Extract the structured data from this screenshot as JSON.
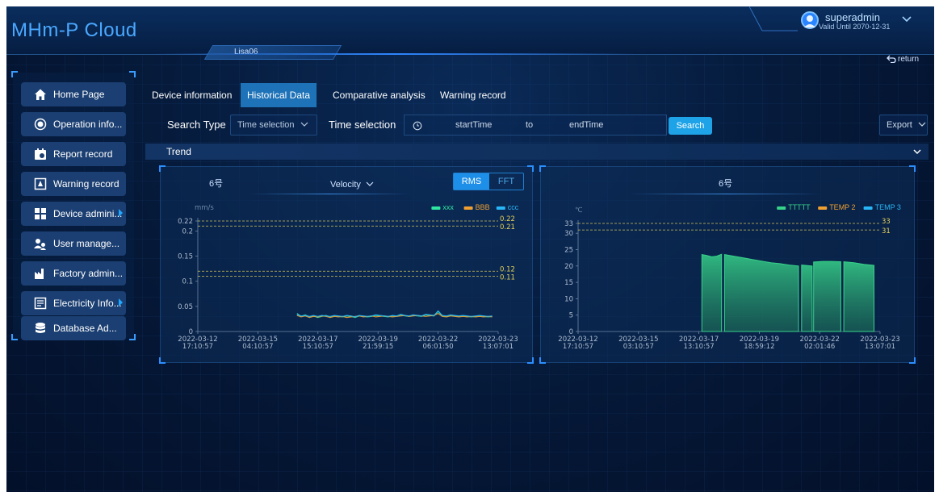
{
  "header": {
    "app_title": "MHm-P Cloud",
    "device_tab": "Lisa06",
    "user_name": "superadmin",
    "valid_until": "Valid Until 2070-12-31",
    "return_label": "return"
  },
  "sidebar": {
    "items": [
      {
        "label": "Home Page",
        "icon": "home-icon",
        "has_submenu": false
      },
      {
        "label": "Operation info...",
        "icon": "target-icon",
        "has_submenu": false
      },
      {
        "label": "Report record",
        "icon": "report-icon",
        "has_submenu": false
      },
      {
        "label": "Warning record",
        "icon": "warning-icon",
        "has_submenu": false
      },
      {
        "label": "Device admini...",
        "icon": "grid-icon",
        "has_submenu": true
      },
      {
        "label": "User manage...",
        "icon": "users-icon",
        "has_submenu": false
      },
      {
        "label": "Factory admin...",
        "icon": "factory-icon",
        "has_submenu": false
      },
      {
        "label": "Electricity Info...",
        "icon": "electricity-icon",
        "has_submenu": true
      },
      {
        "label": "Database Ad...",
        "icon": "database-icon",
        "has_submenu": false
      }
    ]
  },
  "tabs": [
    {
      "label": "Device information",
      "active": false
    },
    {
      "label": "Historical Data",
      "active": true
    },
    {
      "label": "Comparative analysis",
      "active": false
    },
    {
      "label": "Warning record",
      "active": false
    }
  ],
  "search": {
    "search_type_label": "Search Type",
    "search_type_value": "Time selection",
    "time_selection_label": "Time selection",
    "start_placeholder": "startTime",
    "to_label": "to",
    "end_placeholder": "endTime",
    "search_button": "Search",
    "export_button": "Export"
  },
  "trend": {
    "label": "Trend"
  },
  "colors": {
    "accent": "#1ea3e8",
    "series_xxx": "#2ee6a0",
    "series_bbb": "#f0a030",
    "series_ccc": "#29b6f6",
    "series_ttttt": "#37d28a",
    "series_temp2": "#f0a030",
    "series_temp3": "#29b6f6",
    "warning_line": "#e6d25a"
  },
  "chart_data": [
    {
      "type": "line",
      "title": "6号",
      "measure": "Velocity",
      "mode_options": [
        "RMS",
        "FFT"
      ],
      "mode_selected": "RMS",
      "ylabel": "mm/s",
      "ylim": [
        0,
        0.22
      ],
      "yticks": [
        "0",
        "0.05",
        "0.1",
        "0.15",
        "0.2",
        "0.22"
      ],
      "xticks": [
        [
          "2022-03-12",
          "17:10:57"
        ],
        [
          "2022-03-15",
          "04:10:57"
        ],
        [
          "2022-03-17",
          "15:10:57"
        ],
        [
          "2022-03-19",
          "21:59:15"
        ],
        [
          "2022-03-22",
          "06:01:50"
        ],
        [
          "2022-03-23",
          "13:07:01"
        ]
      ],
      "threshold_lines": [
        {
          "value": 0.22,
          "label": "0.22"
        },
        {
          "value": 0.21,
          "label": "0.21"
        },
        {
          "value": 0.12,
          "label": "0.12"
        },
        {
          "value": 0.11,
          "label": "0.11"
        }
      ],
      "series": [
        {
          "name": "xxx",
          "color": "#2ee6a0",
          "x_start": 0.33,
          "x_end": 0.98,
          "values": [
            0.036,
            0.03,
            0.033,
            0.029,
            0.031,
            0.028,
            0.03,
            0.032,
            0.029,
            0.031,
            0.03,
            0.029,
            0.031,
            0.03,
            0.028,
            0.031,
            0.03,
            0.029,
            0.03,
            0.032,
            0.031,
            0.03,
            0.029,
            0.031,
            0.03,
            0.033,
            0.031,
            0.03,
            0.032,
            0.031,
            0.03,
            0.033,
            0.032,
            0.031,
            0.04,
            0.031,
            0.03,
            0.032,
            0.031,
            0.03,
            0.031,
            0.03,
            0.029,
            0.03,
            0.031,
            0.03,
            0.029,
            0.03
          ]
        },
        {
          "name": "BBB",
          "color": "#f0a030",
          "x_start": 0.33,
          "x_end": 0.98,
          "values": [
            0.032,
            0.029,
            0.031,
            0.028,
            0.03,
            0.029,
            0.031,
            0.03,
            0.028,
            0.03,
            0.029,
            0.03,
            0.028,
            0.029,
            0.03,
            0.031,
            0.029,
            0.03,
            0.031,
            0.029,
            0.03,
            0.031,
            0.03,
            0.029,
            0.03,
            0.031,
            0.032,
            0.03,
            0.031,
            0.032,
            0.031,
            0.03,
            0.031,
            0.032,
            0.036,
            0.03,
            0.029,
            0.031,
            0.03,
            0.029,
            0.03,
            0.029,
            0.03,
            0.029,
            0.03,
            0.029,
            0.03,
            0.029
          ]
        },
        {
          "name": "ccc",
          "color": "#29b6f6",
          "x_start": 0.33,
          "x_end": 0.98,
          "values": [
            0.034,
            0.031,
            0.032,
            0.03,
            0.032,
            0.03,
            0.032,
            0.031,
            0.03,
            0.032,
            0.031,
            0.03,
            0.032,
            0.031,
            0.029,
            0.032,
            0.031,
            0.03,
            0.031,
            0.033,
            0.032,
            0.031,
            0.03,
            0.032,
            0.031,
            0.034,
            0.032,
            0.031,
            0.033,
            0.032,
            0.031,
            0.034,
            0.033,
            0.032,
            0.041,
            0.032,
            0.031,
            0.033,
            0.032,
            0.031,
            0.032,
            0.031,
            0.03,
            0.031,
            0.032,
            0.031,
            0.03,
            0.031
          ]
        }
      ]
    },
    {
      "type": "area",
      "title": "6号",
      "ylabel": "℃",
      "ylim": [
        0,
        33
      ],
      "yticks": [
        "0",
        "5",
        "10",
        "15",
        "20",
        "25",
        "30",
        "33"
      ],
      "xticks": [
        [
          "2022-03-12",
          "17:10:57"
        ],
        [
          "2022-03-15",
          "03:10:57"
        ],
        [
          "2022-03-17",
          "13:10:57"
        ],
        [
          "2022-03-19",
          "18:59:12"
        ],
        [
          "2022-03-22",
          "02:01:46"
        ],
        [
          "2022-03-23",
          "13:07:01"
        ]
      ],
      "threshold_lines": [
        {
          "value": 33,
          "label": "33"
        },
        {
          "value": 31,
          "label": "31"
        }
      ],
      "series": [
        {
          "name": "TTTTT",
          "color": "#37d28a",
          "segments": [
            {
              "x_start": 0.41,
              "x_end": 0.475,
              "values": [
                23.5,
                23.2,
                22.8,
                23.0,
                23.6
              ]
            },
            {
              "x_start": 0.485,
              "x_end": 0.73,
              "values": [
                23.5,
                23.0,
                22.5,
                22.0,
                21.5,
                21.0,
                20.7,
                20.3,
                20.0
              ]
            },
            {
              "x_start": 0.74,
              "x_end": 0.775,
              "values": [
                20.3,
                20.0
              ]
            },
            {
              "x_start": 0.78,
              "x_end": 0.87,
              "values": [
                21.2,
                21.4,
                21.4,
                21.3
              ]
            },
            {
              "x_start": 0.88,
              "x_end": 0.98,
              "values": [
                21.3,
                21.0,
                20.5,
                20.2
              ]
            }
          ]
        },
        {
          "name": "TEMP 2",
          "color": "#f0a030",
          "segments": []
        },
        {
          "name": "TEMP 3",
          "color": "#29b6f6",
          "segments": []
        }
      ]
    }
  ]
}
